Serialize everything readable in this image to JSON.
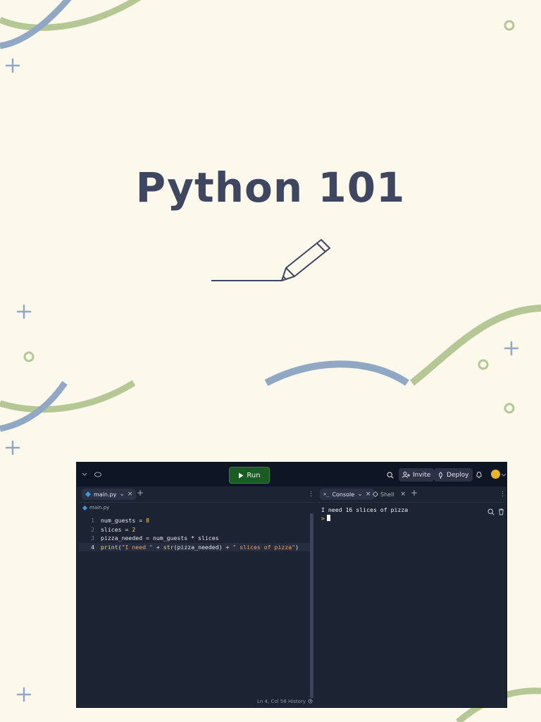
{
  "page": {
    "title": "Python 101"
  },
  "ide": {
    "topbar": {
      "run_label": "Run",
      "invite_label": "Invite",
      "deploy_label": "Deploy"
    },
    "editor": {
      "tab_label": "main.py",
      "breadcrumb": "main.py",
      "line_numbers": [
        "1",
        "2",
        "3",
        "4"
      ],
      "code": {
        "l1_var": "num_guests = ",
        "l1_val": "8",
        "l2_var": "slices = ",
        "l2_val": "2",
        "l3": "pizza_needed = num_guests * slices",
        "l4_fn": "print",
        "l4_open": "(",
        "l4_str1": "\"I need \"",
        "l4_plus1": " + ",
        "l4_str_fn": "str",
        "l4_arg": "(pizza_needed)",
        "l4_plus2": " + ",
        "l4_str2": "\" slices of pizza\"",
        "l4_close": ")"
      },
      "status": {
        "cursor_position": "Ln 4, Col 58",
        "history_label": "History"
      }
    },
    "console": {
      "tab_console": "Console",
      "tab_shell": "Shell",
      "output": "I need 16 slices of pizza",
      "prompt": ">"
    }
  }
}
